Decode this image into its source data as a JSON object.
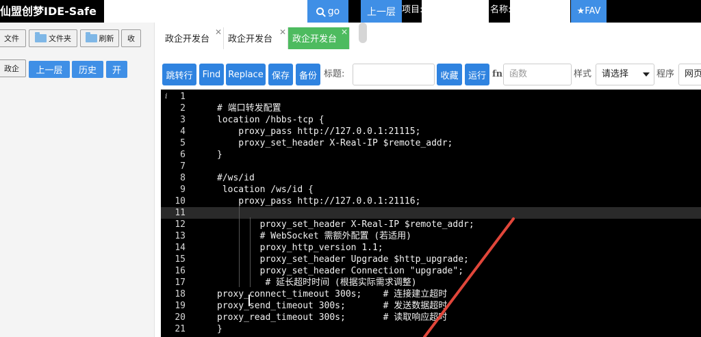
{
  "topbar": {
    "brand": "仙盟创梦IDE-Safe",
    "go_label": "go",
    "up_label": "上一层",
    "project_label": "项目:",
    "name_label": "名称:",
    "fav_label": "★FAV"
  },
  "sidebar": {
    "file_btn": "文件",
    "folder_btn": "文件夹",
    "refresh_btn": "刷新",
    "collect_btn": "收",
    "gov_btn": "政企",
    "up_btn": "上一层",
    "history_btn": "历史",
    "open_btn": "开"
  },
  "tabs": [
    {
      "label": "政企开发台",
      "active": false
    },
    {
      "label": "政企开发台",
      "active": false
    },
    {
      "label": "政企开发台",
      "active": true
    }
  ],
  "toolbar": {
    "jump_btn": "跳转行",
    "find_btn": "Find",
    "replace_btn": "Replace",
    "save_btn": "保存",
    "backup_btn": "备份",
    "title_label": "标题:",
    "collect_btn": "收藏",
    "run_btn": "运行",
    "fn_label": "fn",
    "func_placeholder": "函数",
    "style_label": "样式",
    "style_value": "请选择",
    "program_label": "程序",
    "program_value": "网页"
  },
  "editor": {
    "info_icon": "i",
    "current_line": 11,
    "lines": [
      {
        "n": "1",
        "t": ""
      },
      {
        "n": "2",
        "t": "# 端口转发配置"
      },
      {
        "n": "3",
        "t": "location /hbbs-tcp {"
      },
      {
        "n": "4",
        "t": "    proxy_pass http://127.0.0.1:21115;"
      },
      {
        "n": "5",
        "t": "    proxy_set_header X-Real-IP $remote_addr;"
      },
      {
        "n": "6",
        "t": "}"
      },
      {
        "n": "7",
        "t": ""
      },
      {
        "n": "8",
        "t": "#/ws/id"
      },
      {
        "n": "9",
        "t": " location /ws/id {"
      },
      {
        "n": "10",
        "t": "    proxy_pass http://127.0.0.1:21116;"
      },
      {
        "n": "11",
        "t": ""
      },
      {
        "n": "12",
        "t": "        proxy_set_header X-Real-IP $remote_addr;"
      },
      {
        "n": "13",
        "t": "        # WebSocket 需额外配置 (若适用)"
      },
      {
        "n": "14",
        "t": "        proxy_http_version 1.1;"
      },
      {
        "n": "15",
        "t": "        proxy_set_header Upgrade $http_upgrade;"
      },
      {
        "n": "16",
        "t": "        proxy_set_header Connection \"upgrade\";"
      },
      {
        "n": "17",
        "t": "         # 延长超时时间 (根据实际需求调整)"
      },
      {
        "n": "18",
        "t": "proxy_connect_timeout 300s;    # 连接建立超时"
      },
      {
        "n": "19",
        "t": "proxy_send_timeout 300s;       # 发送数据超时"
      },
      {
        "n": "20",
        "t": "proxy_read_timeout 300s;       # 读取响应超时"
      },
      {
        "n": "21",
        "t": "}"
      }
    ]
  },
  "colors": {
    "accent": "#3f8fe6",
    "active_tab": "#4dbb5f",
    "annotation_arrow": "#e0463a"
  }
}
